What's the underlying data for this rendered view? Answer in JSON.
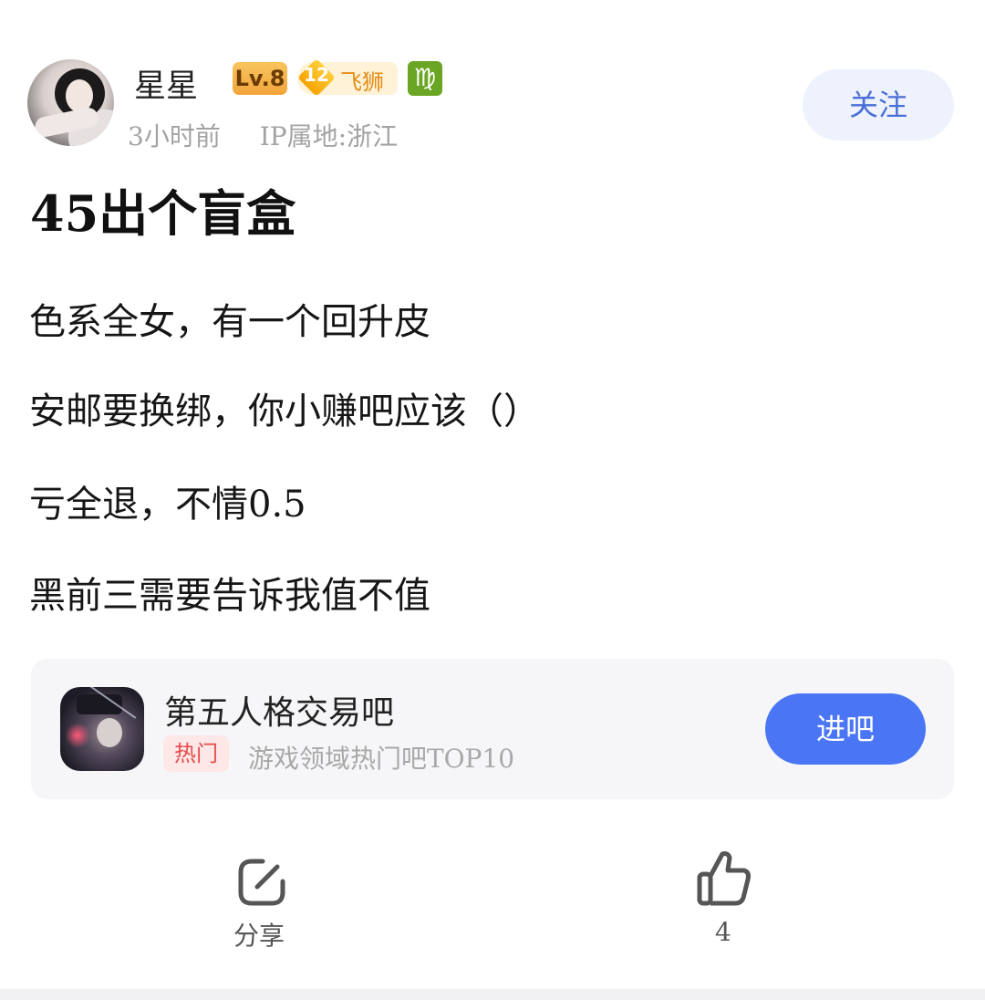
{
  "post": {
    "author": {
      "name": "星星",
      "level_badge": "Lv.8",
      "fan_level": "12",
      "fan_title": "飞狮",
      "zodiac_symbol": "♍",
      "time": "3小时前",
      "ip_location": "IP属地:浙江"
    },
    "follow_label": "关注",
    "title": "45出个盲盒",
    "lines": [
      "色系全女，有一个回升皮",
      "安邮要换绑，你小赚吧应该（）",
      "亏全退，不情0.5",
      "黑前三需要告诉我值不值"
    ]
  },
  "forum": {
    "name": "第五人格交易吧",
    "tag": "热门",
    "description": "游戏领域热门吧TOP10",
    "enter_label": "进吧"
  },
  "actions": {
    "share_label": "分享",
    "like_count": "4"
  },
  "colors": {
    "follow_bg": "#eef2fc",
    "follow_text": "#4a6fd8",
    "enter_bg": "#4a76f5",
    "hot_tag_bg": "#fde7e7",
    "hot_tag_text": "#e74a4a",
    "level_badge": "#f1a53c",
    "zodiac_badge": "#6aa624"
  },
  "icons": {
    "share": "share-icon",
    "like": "thumbs-up-icon"
  }
}
